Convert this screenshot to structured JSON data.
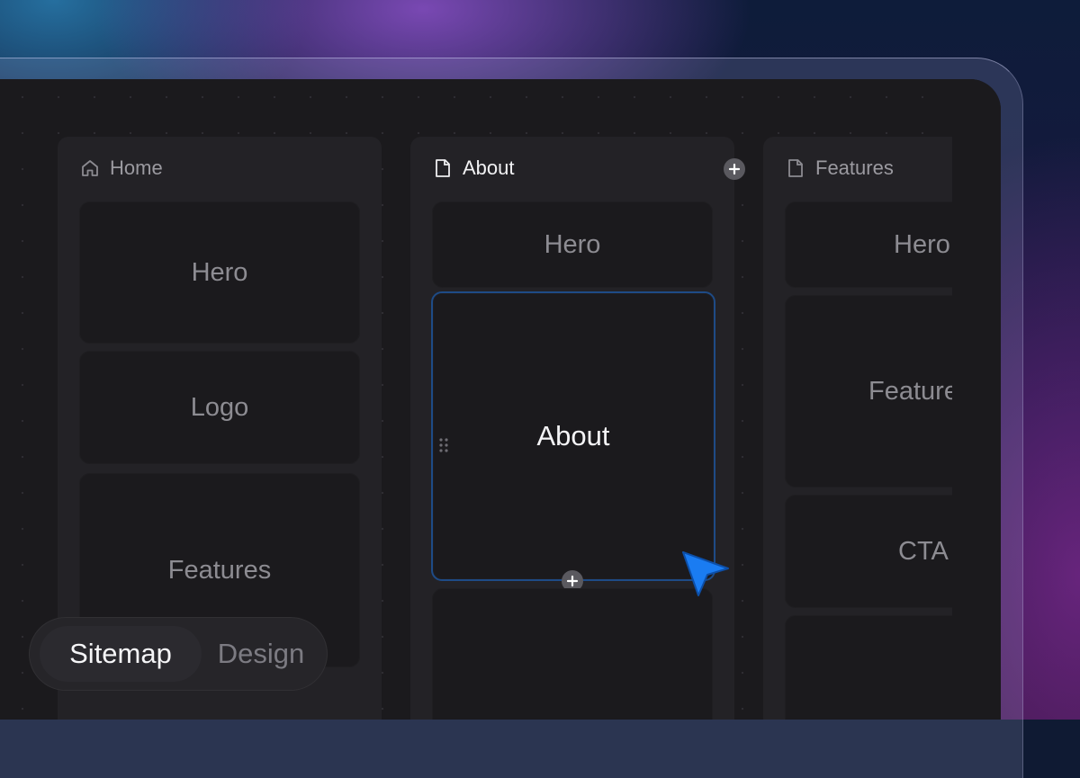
{
  "columns": [
    {
      "page_name": "Home",
      "icon": "home-icon",
      "sections": [
        "Hero",
        "Logo",
        "Features"
      ]
    },
    {
      "page_name": "About",
      "icon": "page-icon",
      "sections": [
        "Hero",
        "About"
      ]
    },
    {
      "page_name": "Features",
      "icon": "page-icon",
      "sections": [
        "Hero",
        "Features",
        "CTA"
      ]
    }
  ],
  "view_switcher": {
    "options": [
      "Sitemap",
      "Design"
    ],
    "selected": "Sitemap"
  },
  "colors": {
    "selection_border": "#1e4b86",
    "cursor": "#1a7cf2"
  }
}
